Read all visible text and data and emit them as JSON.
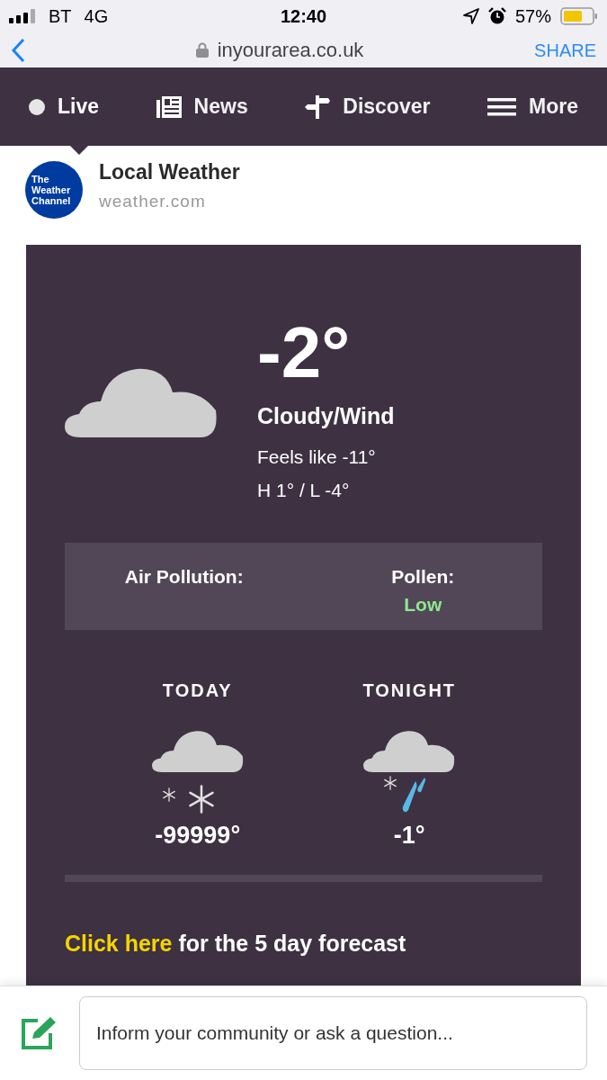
{
  "status_bar": {
    "carrier": "BT",
    "network": "4G",
    "time": "12:40",
    "battery": "57%"
  },
  "browser": {
    "url": "inyourarea.co.uk",
    "share": "SHARE"
  },
  "nav": [
    {
      "label": "Live",
      "kind": "live",
      "selected": true
    },
    {
      "label": "News",
      "kind": "news",
      "selected": false
    },
    {
      "label": "Discover",
      "kind": "discover",
      "selected": false
    },
    {
      "label": "More",
      "kind": "more",
      "selected": false
    }
  ],
  "source": {
    "logo_text": "The Weather Channel",
    "title": "Local Weather",
    "domain": "weather.com"
  },
  "current": {
    "temperature": "-2°",
    "condition": "Cloudy/Wind",
    "feels_like": "Feels like -11°",
    "high_low": "H 1° / L -4°"
  },
  "conditions": [
    {
      "label": "Air Pollution:"
    },
    {
      "label": "Pollen:",
      "value": "Low",
      "color": "#8ee88e"
    }
  ],
  "periods": [
    {
      "label": "TODAY",
      "kind": "snow",
      "temperature": "-99999°"
    },
    {
      "label": "TONIGHT",
      "kind": "sleet",
      "temperature": "-1°"
    }
  ],
  "forecast_link": {
    "link": "Click here",
    "rest": "for the 5 day forecast"
  },
  "composer": {
    "placeholder": "Inform your community or ask a question..."
  }
}
